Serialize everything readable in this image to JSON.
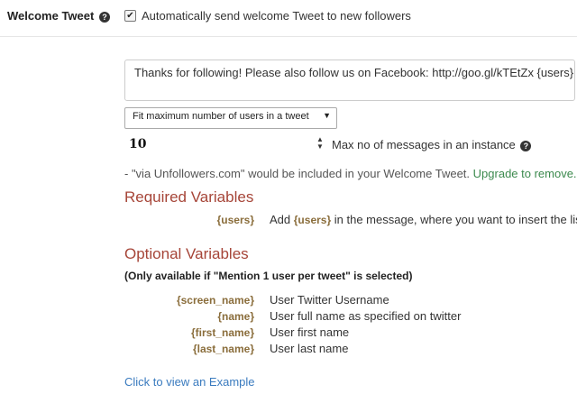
{
  "welcome": {
    "label": "Welcome Tweet",
    "help_icon": "question-circle-icon",
    "checkbox_checked": true,
    "checkbox_label": "Automatically send welcome Tweet to new followers"
  },
  "message": {
    "value": "Thanks for following! Please also follow us on Facebook: http://goo.gl/kTEtZx {users}"
  },
  "mode_select": {
    "selected": "Fit maximum number of users in a tweet"
  },
  "max_messages": {
    "value": "10",
    "label": "Max no of messages in an instance",
    "help_icon": "question-circle-icon"
  },
  "via_note": {
    "text": "- \"via Unfollowers.com\" would be included in your Welcome Tweet.",
    "link": "Upgrade to remove."
  },
  "required": {
    "heading": "Required Variables",
    "items": [
      {
        "name": "{users}",
        "desc_prefix": "Add",
        "desc_var": "{users}",
        "desc_suffix": "in the message, where you want to insert the list"
      }
    ]
  },
  "optional": {
    "heading": "Optional Variables",
    "note": "(Only available if \"Mention 1 user per tweet\" is selected)",
    "items": [
      {
        "name": "{screen_name}",
        "desc": "User Twitter Username"
      },
      {
        "name": "{name}",
        "desc": "User full name as specified on twitter"
      },
      {
        "name": "{first_name}",
        "desc": "User first name"
      },
      {
        "name": "{last_name}",
        "desc": "User last name"
      }
    ]
  },
  "example_link": "Click to view an Example",
  "colors": {
    "heading": "#a64538",
    "variable": "#8a6d3b",
    "link_blue": "#3a7bbf",
    "link_green": "#3c8a4e"
  }
}
